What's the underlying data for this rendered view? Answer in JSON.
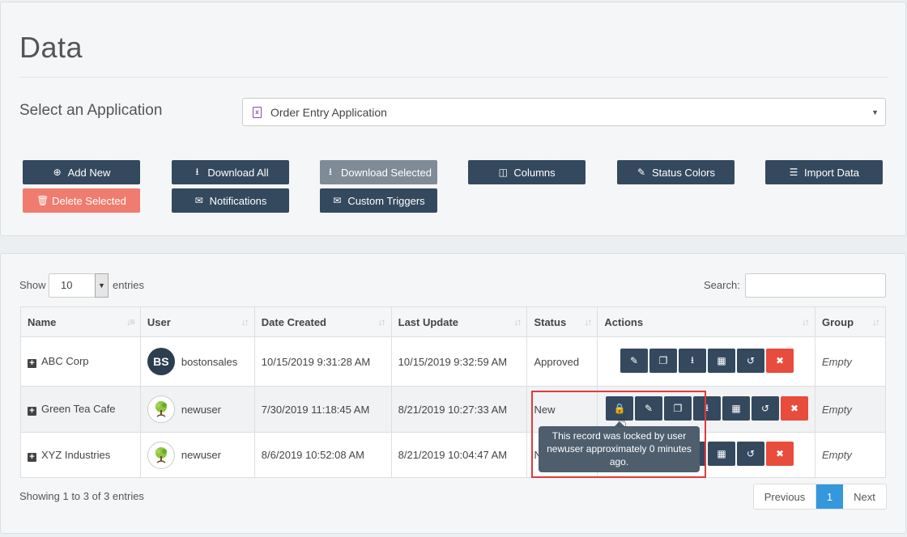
{
  "page": {
    "title": "Data"
  },
  "app_selector": {
    "label": "Select an Application",
    "value": "Order Entry Application"
  },
  "toolbar": {
    "add_new": "Add New",
    "download_all": "Download All",
    "download_selected": "Download Selected",
    "columns": "Columns",
    "status_colors": "Status Colors",
    "import_data": "Import Data",
    "delete_selected": "Delete Selected",
    "notifications": "Notifications",
    "custom_triggers": "Custom Triggers"
  },
  "table_controls": {
    "show": "Show",
    "length": "10",
    "entries": "entries",
    "search": "Search:"
  },
  "columns": [
    "Name",
    "User",
    "Date Created",
    "Last Update",
    "Status",
    "Actions",
    "Group"
  ],
  "rows": [
    {
      "name": "ABC Corp",
      "avatar": "BS",
      "user": "bostonsales",
      "created": "10/15/2019 9:31:28 AM",
      "updated": "10/15/2019 9:32:59 AM",
      "status": "Approved",
      "group": "Empty"
    },
    {
      "name": "Green Tea Cafe",
      "user": "newuser",
      "created": "7/30/2019 11:18:45 AM",
      "updated": "8/21/2019 10:27:33 AM",
      "status": "New",
      "group": "Empty"
    },
    {
      "name": "XYZ Industries",
      "user": "newuser",
      "created": "8/6/2019 10:52:08 AM",
      "updated": "8/21/2019 10:04:47 AM",
      "status": "New",
      "group": "Empty"
    }
  ],
  "tooltip": {
    "text": "This record was locked by user newuser approximately 0 minutes ago."
  },
  "footer": {
    "info": "Showing 1 to 3 of 3 entries",
    "previous": "Previous",
    "page": "1",
    "next": "Next"
  },
  "colors": {
    "primary": "#34495e",
    "danger": "#e74c3c",
    "danger_light": "#ef7c6e",
    "disabled": "#7f8b96",
    "pager_active": "#3498db"
  }
}
